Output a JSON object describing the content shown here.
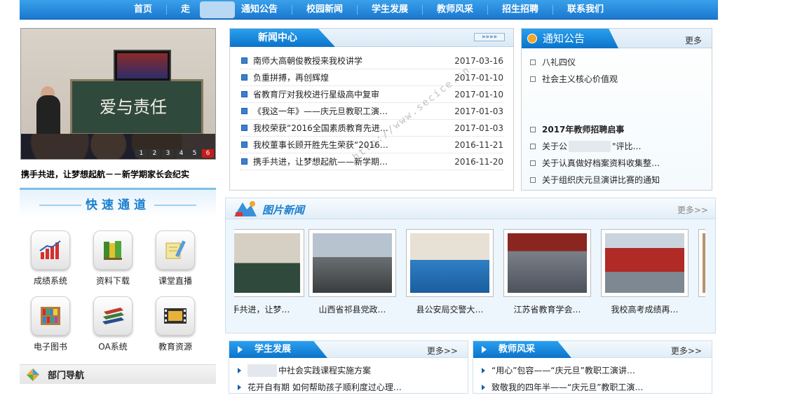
{
  "nav": {
    "items": [
      "首页",
      "走",
      "通知公告",
      "校园新闻",
      "学生发展",
      "教师风采",
      "招生招聘",
      "联系我们"
    ]
  },
  "slideshow": {
    "board_text": "爱与责任",
    "pages": [
      "1",
      "2",
      "3",
      "4",
      "5",
      "6"
    ],
    "active_page": "6",
    "caption": "携手共进，让梦想起航－－新学期家长会纪实"
  },
  "quick_access": {
    "title": "快速通道",
    "items": [
      {
        "label": "成绩系统",
        "icon": "bar-chart-icon"
      },
      {
        "label": "资料下载",
        "icon": "books-icon"
      },
      {
        "label": "课堂直播",
        "icon": "notebook-pen-icon"
      },
      {
        "label": "电子图书",
        "icon": "bookshelf-icon"
      },
      {
        "label": "OA系统",
        "icon": "stacked-books-icon"
      },
      {
        "label": "教育资源",
        "icon": "film-strip-icon"
      }
    ]
  },
  "department_nav": {
    "title": "部门导航"
  },
  "news_center": {
    "title": "新闻中心",
    "more": "»»»»",
    "items": [
      {
        "title": "南师大高朝俊教授来我校讲学",
        "date": "2017-03-16"
      },
      {
        "title": "负重拼搏，再创辉煌",
        "date": "2017-01-10"
      },
      {
        "title": "省教育厅对我校进行星级高中复审",
        "date": "2017-01-10"
      },
      {
        "title": "《我这一年》——庆元旦教职工演…",
        "date": "2017-01-03"
      },
      {
        "title": "我校荣获“2016全国素质教育先进…",
        "date": "2017-01-03"
      },
      {
        "title": "我校董事长顾开胜先生荣获“2016…",
        "date": "2016-11-21"
      },
      {
        "title": "携手共进，让梦想起航——新学期…",
        "date": "2016-11-20"
      }
    ]
  },
  "notice": {
    "title": "通知公告",
    "more": "更多",
    "items": [
      {
        "text": "八礼四仪",
        "bold": false
      },
      {
        "text": "社会主义核心价值观",
        "bold": false
      },
      {
        "text": "",
        "bold": false
      },
      {
        "text": "",
        "bold": false
      },
      {
        "text": "2017年教师招聘启事",
        "bold": true
      },
      {
        "text": "关于公",
        "bold": false
      },
      {
        "text": "关于认真做好档案资料收集整…",
        "bold": false
      },
      {
        "text": "关于组织庆元旦演讲比赛的通知",
        "bold": false
      }
    ],
    "partial_tail": "\"评比…"
  },
  "picture_news": {
    "title": "图片新闻",
    "more": "更多>>",
    "items": [
      {
        "caption": "手共进，让梦…"
      },
      {
        "caption": "山西省祁县党政…"
      },
      {
        "caption": "县公安局交警大…"
      },
      {
        "caption": "江苏省教育学会…"
      },
      {
        "caption": "我校高考成绩再…"
      }
    ]
  },
  "student_dev": {
    "title": "学生发展",
    "more": "更多>>",
    "items": [
      "中社会实践课程实施方案",
      "花开自有期 如何帮助孩子顺利度过心理…"
    ]
  },
  "teacher_style": {
    "title": "教师风采",
    "more": "更多>>",
    "items": [
      "“用心”包容——“庆元旦”教职工演讲…",
      "致敬我的四年半——“庆元旦”教职工演…"
    ]
  },
  "watermark": "http://www.secice.cn"
}
